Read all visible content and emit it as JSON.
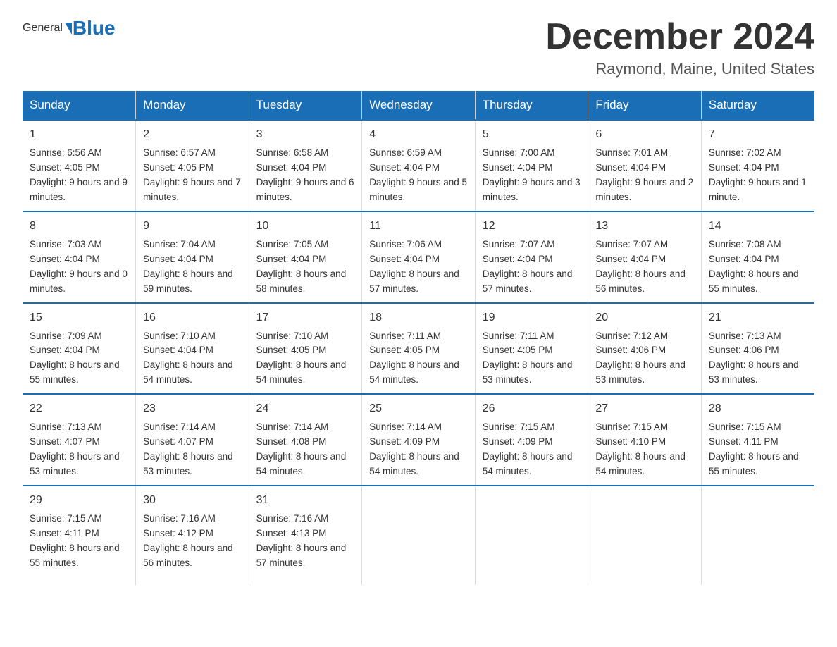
{
  "logo": {
    "general": "General",
    "blue": "Blue"
  },
  "title": "December 2024",
  "subtitle": "Raymond, Maine, United States",
  "weekdays": [
    "Sunday",
    "Monday",
    "Tuesday",
    "Wednesday",
    "Thursday",
    "Friday",
    "Saturday"
  ],
  "weeks": [
    [
      {
        "day": "1",
        "sunrise": "6:56 AM",
        "sunset": "4:05 PM",
        "daylight": "9 hours and 9 minutes."
      },
      {
        "day": "2",
        "sunrise": "6:57 AM",
        "sunset": "4:05 PM",
        "daylight": "9 hours and 7 minutes."
      },
      {
        "day": "3",
        "sunrise": "6:58 AM",
        "sunset": "4:04 PM",
        "daylight": "9 hours and 6 minutes."
      },
      {
        "day": "4",
        "sunrise": "6:59 AM",
        "sunset": "4:04 PM",
        "daylight": "9 hours and 5 minutes."
      },
      {
        "day": "5",
        "sunrise": "7:00 AM",
        "sunset": "4:04 PM",
        "daylight": "9 hours and 3 minutes."
      },
      {
        "day": "6",
        "sunrise": "7:01 AM",
        "sunset": "4:04 PM",
        "daylight": "9 hours and 2 minutes."
      },
      {
        "day": "7",
        "sunrise": "7:02 AM",
        "sunset": "4:04 PM",
        "daylight": "9 hours and 1 minute."
      }
    ],
    [
      {
        "day": "8",
        "sunrise": "7:03 AM",
        "sunset": "4:04 PM",
        "daylight": "9 hours and 0 minutes."
      },
      {
        "day": "9",
        "sunrise": "7:04 AM",
        "sunset": "4:04 PM",
        "daylight": "8 hours and 59 minutes."
      },
      {
        "day": "10",
        "sunrise": "7:05 AM",
        "sunset": "4:04 PM",
        "daylight": "8 hours and 58 minutes."
      },
      {
        "day": "11",
        "sunrise": "7:06 AM",
        "sunset": "4:04 PM",
        "daylight": "8 hours and 57 minutes."
      },
      {
        "day": "12",
        "sunrise": "7:07 AM",
        "sunset": "4:04 PM",
        "daylight": "8 hours and 57 minutes."
      },
      {
        "day": "13",
        "sunrise": "7:07 AM",
        "sunset": "4:04 PM",
        "daylight": "8 hours and 56 minutes."
      },
      {
        "day": "14",
        "sunrise": "7:08 AM",
        "sunset": "4:04 PM",
        "daylight": "8 hours and 55 minutes."
      }
    ],
    [
      {
        "day": "15",
        "sunrise": "7:09 AM",
        "sunset": "4:04 PM",
        "daylight": "8 hours and 55 minutes."
      },
      {
        "day": "16",
        "sunrise": "7:10 AM",
        "sunset": "4:04 PM",
        "daylight": "8 hours and 54 minutes."
      },
      {
        "day": "17",
        "sunrise": "7:10 AM",
        "sunset": "4:05 PM",
        "daylight": "8 hours and 54 minutes."
      },
      {
        "day": "18",
        "sunrise": "7:11 AM",
        "sunset": "4:05 PM",
        "daylight": "8 hours and 54 minutes."
      },
      {
        "day": "19",
        "sunrise": "7:11 AM",
        "sunset": "4:05 PM",
        "daylight": "8 hours and 53 minutes."
      },
      {
        "day": "20",
        "sunrise": "7:12 AM",
        "sunset": "4:06 PM",
        "daylight": "8 hours and 53 minutes."
      },
      {
        "day": "21",
        "sunrise": "7:13 AM",
        "sunset": "4:06 PM",
        "daylight": "8 hours and 53 minutes."
      }
    ],
    [
      {
        "day": "22",
        "sunrise": "7:13 AM",
        "sunset": "4:07 PM",
        "daylight": "8 hours and 53 minutes."
      },
      {
        "day": "23",
        "sunrise": "7:14 AM",
        "sunset": "4:07 PM",
        "daylight": "8 hours and 53 minutes."
      },
      {
        "day": "24",
        "sunrise": "7:14 AM",
        "sunset": "4:08 PM",
        "daylight": "8 hours and 54 minutes."
      },
      {
        "day": "25",
        "sunrise": "7:14 AM",
        "sunset": "4:09 PM",
        "daylight": "8 hours and 54 minutes."
      },
      {
        "day": "26",
        "sunrise": "7:15 AM",
        "sunset": "4:09 PM",
        "daylight": "8 hours and 54 minutes."
      },
      {
        "day": "27",
        "sunrise": "7:15 AM",
        "sunset": "4:10 PM",
        "daylight": "8 hours and 54 minutes."
      },
      {
        "day": "28",
        "sunrise": "7:15 AM",
        "sunset": "4:11 PM",
        "daylight": "8 hours and 55 minutes."
      }
    ],
    [
      {
        "day": "29",
        "sunrise": "7:15 AM",
        "sunset": "4:11 PM",
        "daylight": "8 hours and 55 minutes."
      },
      {
        "day": "30",
        "sunrise": "7:16 AM",
        "sunset": "4:12 PM",
        "daylight": "8 hours and 56 minutes."
      },
      {
        "day": "31",
        "sunrise": "7:16 AM",
        "sunset": "4:13 PM",
        "daylight": "8 hours and 57 minutes."
      },
      null,
      null,
      null,
      null
    ]
  ],
  "labels": {
    "sunrise": "Sunrise:",
    "sunset": "Sunset:",
    "daylight": "Daylight:"
  }
}
